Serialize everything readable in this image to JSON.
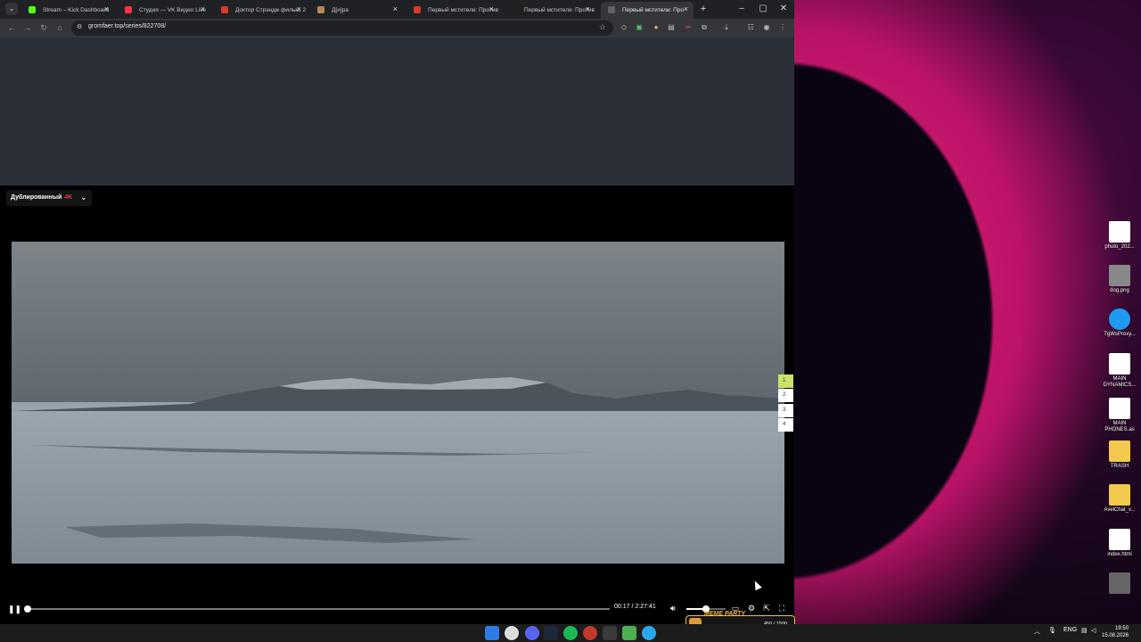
{
  "browser": {
    "tabs": [
      {
        "title": "Stream – Kick Dashboard",
        "color": "#53fc18"
      },
      {
        "title": "Студия — VK Видео Live",
        "color": "#ff3347"
      },
      {
        "title": "Доктор Стрэндж фильм, 2",
        "color": "#d43b2a"
      },
      {
        "title": "Д[и]ра",
        "color": "#b08a5a"
      },
      {
        "title": "Первый мстители: Против",
        "color": "#d43b2a"
      },
      {
        "title": "Первый мстители: Против",
        "color": "#202020"
      },
      {
        "title": "Первый мстители: Про",
        "color": "#5f6368",
        "active": true
      }
    ],
    "url": "gromfaer.top/series/822708/"
  },
  "player": {
    "dub_label": "Дублированный",
    "quality": "4K",
    "current_time": "00:17",
    "separator": "/",
    "duration": "2:27:41",
    "progress": 0.0019,
    "volume": 0.5,
    "episodes": [
      "1",
      "2",
      "3",
      "4"
    ],
    "active_episode": "1"
  },
  "desktop": {
    "icons": [
      {
        "label": "photo_202...",
        "icon": "qr-icon",
        "color": "#ffffff"
      },
      {
        "label": "dog.png",
        "icon": "image-icon",
        "color": "#888888"
      },
      {
        "label": "TgWsProxy...",
        "icon": "telegram-icon",
        "color": "#1d9bf0"
      },
      {
        "label": "MAIN DYNAMICS...",
        "icon": "file-icon",
        "color": "#ffffff"
      },
      {
        "label": "MAIN PHONES.as",
        "icon": "file-icon",
        "color": "#ffffff"
      },
      {
        "label": "TRASH",
        "icon": "folder-icon",
        "color": "#f2c94c"
      },
      {
        "label": "AvelChat_v...",
        "icon": "folder-icon",
        "color": "#f2c94c"
      },
      {
        "label": "index.html",
        "icon": "chrome-icon",
        "color": "#ffffff"
      },
      {
        "label": "",
        "icon": "archive-icon",
        "color": "#666666"
      }
    ]
  },
  "party": {
    "title": "MEME PARTY",
    "count": "450 / 1500"
  },
  "taskbar": {
    "lang": "ENG",
    "time": "19:50",
    "date": "15.08.2026"
  }
}
